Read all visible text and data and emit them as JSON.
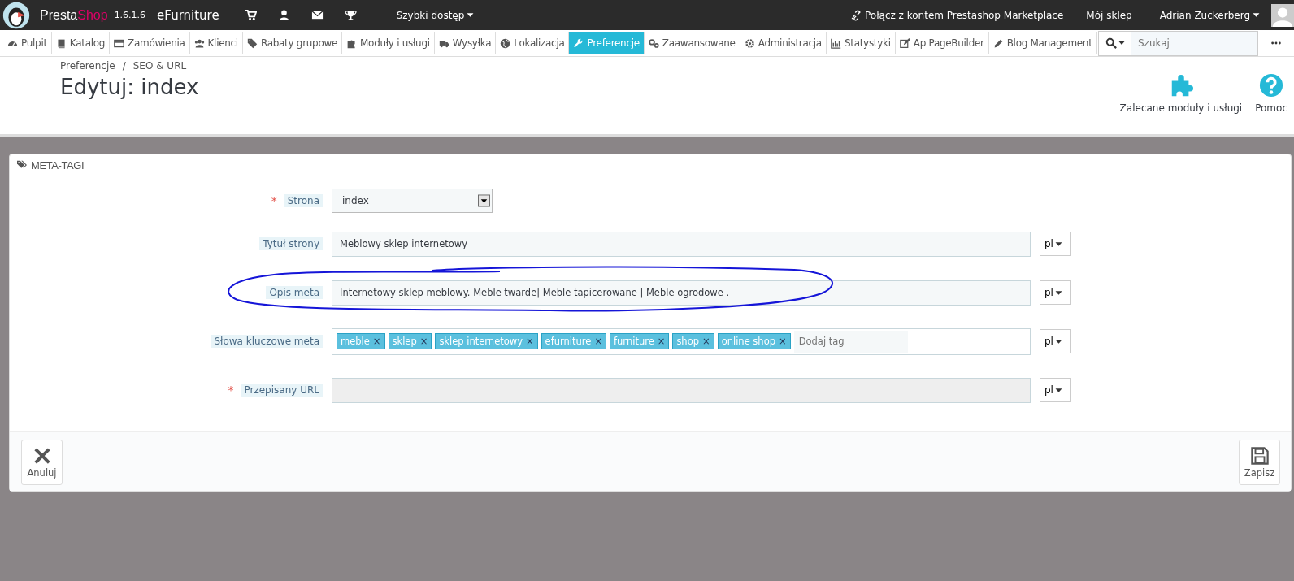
{
  "top_bar": {
    "brand": [
      "Presta",
      "Shop"
    ],
    "version": "1.6.1.6",
    "shop_name": "eFurniture",
    "quick_access": "Szybki dostęp",
    "marketplace": "Połącz z kontem Prestashop Marketplace",
    "my_shop": "Mój sklep",
    "user": "Adrian Zuckerberg"
  },
  "nav": {
    "items": [
      {
        "label": "Pulpit",
        "selected": false
      },
      {
        "label": "Katalog",
        "selected": false
      },
      {
        "label": "Zamówienia",
        "selected": false
      },
      {
        "label": "Klienci",
        "selected": false
      },
      {
        "label": "Rabaty grupowe",
        "selected": false
      },
      {
        "label": "Moduły i usługi",
        "selected": false
      },
      {
        "label": "Wysyłka",
        "selected": false
      },
      {
        "label": "Lokalizacja",
        "selected": false
      },
      {
        "label": "Preferencje",
        "selected": true
      },
      {
        "label": "Zaawansowane",
        "selected": false
      },
      {
        "label": "Administracja",
        "selected": false
      },
      {
        "label": "Statystyki",
        "selected": false
      },
      {
        "label": "Ap PageBuilder",
        "selected": false
      },
      {
        "label": "Blog Management",
        "selected": false
      }
    ],
    "search": {
      "placeholder": "Szukaj"
    }
  },
  "page_header": {
    "breadcrumb": [
      "Preferencje",
      "SEO & URL"
    ],
    "breadcrumb_separator": "/",
    "title": "Edytuj: index",
    "actions": [
      "Zalecane moduły i usługi",
      "Pomoc"
    ]
  },
  "panel": {
    "title": "META-TAGI",
    "fields": [
      {
        "kind": "select",
        "label": "Strona",
        "required_mark": "*",
        "value": "index"
      },
      {
        "kind": "text",
        "label": "Tytuł strony",
        "value": "Meblowy sklep internetowy",
        "lang": "pl"
      },
      {
        "kind": "text",
        "label": "Opis meta",
        "value": "Internetowy sklep meblowy. Meble twarde| Meble tapicerowane | Meble ogrodowe .",
        "lang": "pl"
      },
      {
        "kind": "tags",
        "label": "Słowa kluczowe meta",
        "tags": [
          "meble",
          "sklep",
          "sklep internetowy",
          "efurniture",
          "furniture",
          "shop",
          "online shop"
        ],
        "tag_remove": "×",
        "placeholder": "Dodaj tag",
        "lang": "pl"
      },
      {
        "kind": "text",
        "label": "Przepisany URL",
        "required_mark": "*",
        "lang": "pl",
        "disabled": true
      }
    ],
    "buttons": [
      "Anuluj",
      "Zapisz"
    ]
  }
}
